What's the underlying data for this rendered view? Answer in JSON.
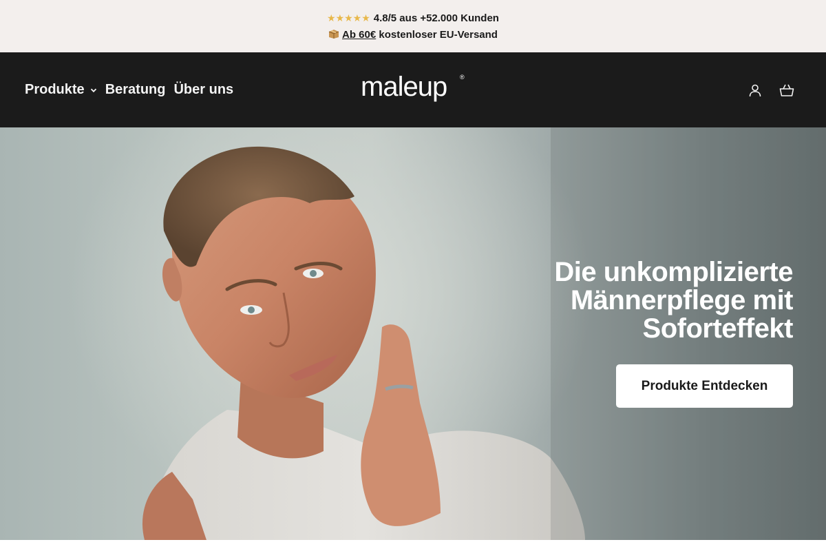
{
  "announcement": {
    "stars": "★★★★★",
    "rating_text": "4.8/5 aus +52.000 Kunden",
    "shipping_highlight": "Ab 60€",
    "shipping_rest": "kostenloser EU-Versand",
    "box_icon": "package-icon"
  },
  "header": {
    "nav": [
      {
        "label": "Produkte",
        "has_dropdown": true
      },
      {
        "label": "Beratung"
      },
      {
        "label": "Über uns"
      }
    ],
    "logo": {
      "text": "maleup",
      "mark": "®"
    },
    "icons": [
      "account-icon",
      "basket-icon"
    ]
  },
  "hero": {
    "title_lines": [
      "Die unkomplizierte",
      "Männerpflege mit",
      "Soforteffekt"
    ],
    "cta_label": "Produkte Entdecken"
  },
  "colors": {
    "announcement_bg": "#f3efed",
    "header_bg": "#1b1b1b",
    "star_color": "#e8b84a",
    "cta_bg": "#ffffff"
  }
}
